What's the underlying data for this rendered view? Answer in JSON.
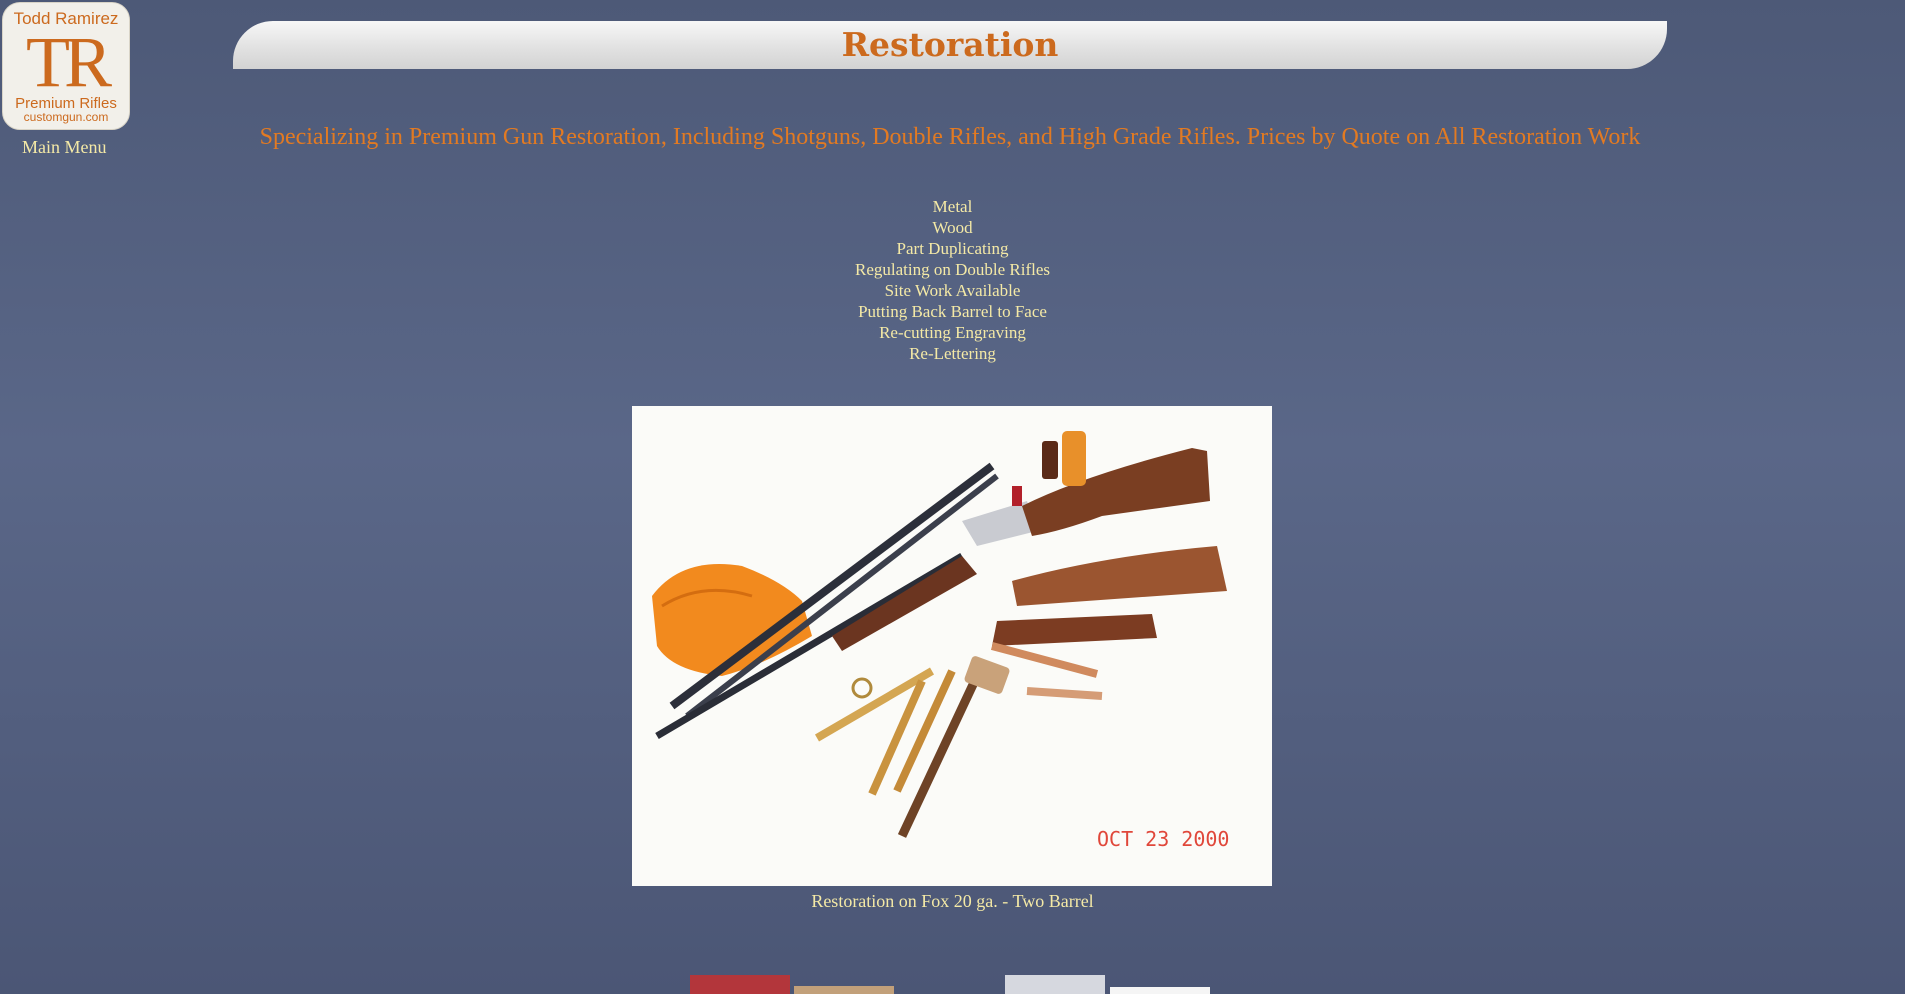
{
  "logo": {
    "name": "Todd Ramirez",
    "monogram": "TR",
    "line2": "Premium Rifles",
    "url": "customgun.com"
  },
  "nav": {
    "main_menu": "Main Menu"
  },
  "page": {
    "title": "Restoration",
    "tagline": "Specializing in Premium Gun Restoration, Including Shotguns, Double Rifles, and High Grade Rifles. Prices by Quote on All Restoration Work"
  },
  "services": [
    "Metal",
    "Wood",
    "Part Duplicating",
    "Regulating on Double Rifles",
    "Site Work Available",
    "Putting Back Barrel to Face",
    "Re-cutting Engraving",
    "Re-Lettering"
  ],
  "photo": {
    "date_stamp": "OCT 23 2000",
    "caption": "Restoration on Fox 20 ga. - Two Barrel"
  },
  "colors": {
    "background": "#4f5b7a",
    "accent": "#cc6a1e",
    "link": "#f4e9a6"
  }
}
